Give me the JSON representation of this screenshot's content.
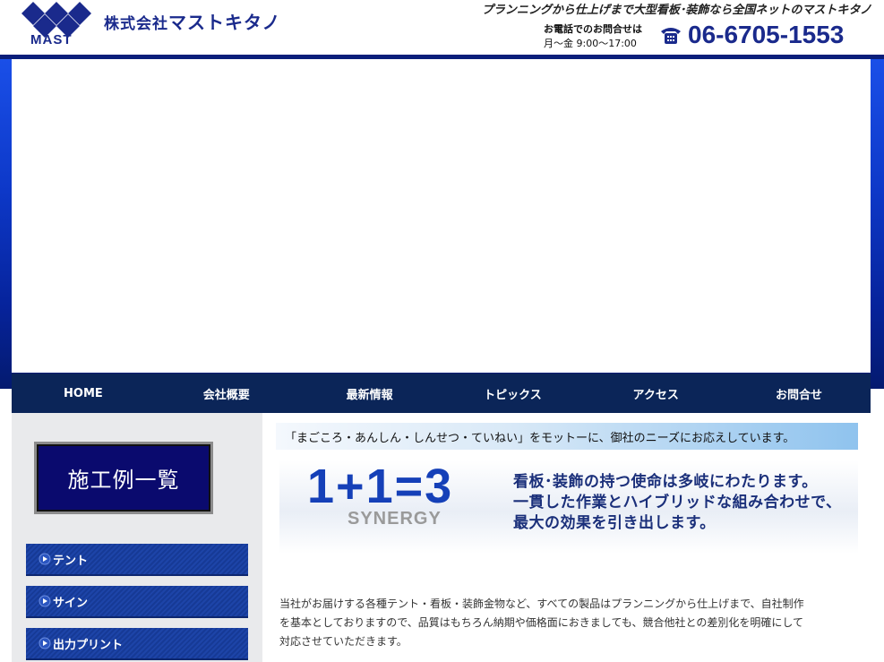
{
  "header": {
    "logo_text": "MAST",
    "company_prefix": "株式会社",
    "company_name": "マストキタノ",
    "tagline": "プランニングから仕上げまで大型看板･装飾なら全国ネットのマストキタノ",
    "contact_label": "お電話でのお問合せは",
    "contact_hours": "月～金 9:00～17:00",
    "phone_icon": "telephone-icon",
    "phone_number": "06-6705-1553",
    "brand_color": "#1a2a8c"
  },
  "nav": {
    "items": [
      "HOME",
      "会社概要",
      "最新情報",
      "トピックス",
      "アクセス",
      "お問合せ"
    ],
    "background": "#0b2558"
  },
  "sidebar": {
    "works_label": "施工例一覧",
    "buttons": [
      "テント",
      "サイン",
      "出力プリント"
    ],
    "arrow_icon": "triangle-right-icon"
  },
  "main": {
    "motto": "「まごころ・あんしん・しんせつ・ていねい」をモットーに、御社のニーズにお応えしています。",
    "synergy_equation": "1+1=3",
    "synergy_word": "SYNERGY",
    "synergy_lines": [
      "看板･装飾の持つ使命は多岐にわたります。",
      "一貫した作業とハイブリッドな組み合わせで、",
      "最大の効果を引き出します。"
    ],
    "body_lines": [
      "当社がお届けする各種テント・看板・装飾金物など、すべての製品はプランニングから仕上げまで、自社制作",
      "を基本としておりますので、品質はもちろん納期や価格面におきましても、競合他社との差別化を明確にして",
      "対応させていただきます。"
    ]
  }
}
